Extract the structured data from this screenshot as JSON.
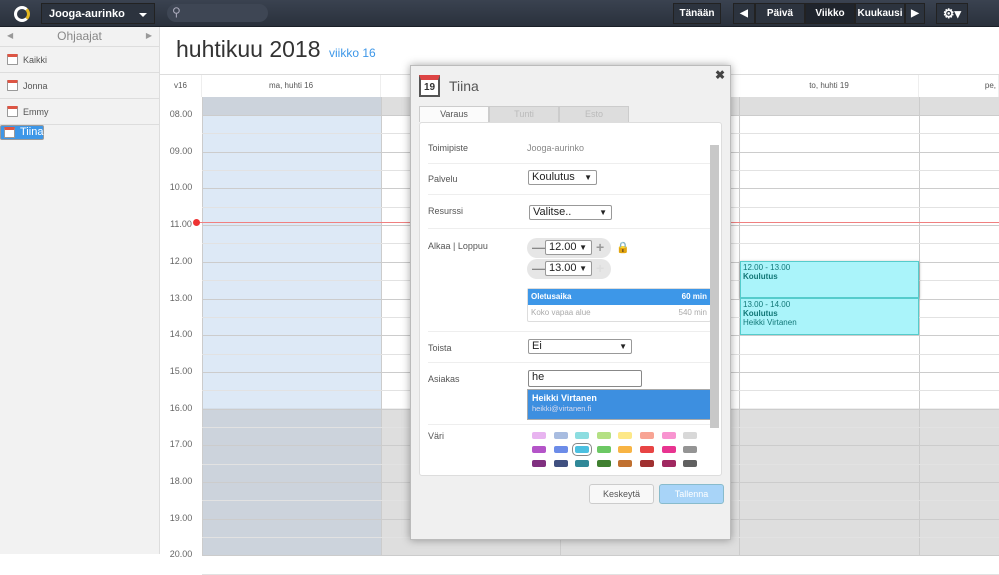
{
  "topbar": {
    "location": "Jooga-aurinko",
    "today": "Tänään",
    "day": "Päivä",
    "week": "Viikko",
    "month": "Kuukausi"
  },
  "sidebar": {
    "title": "Ohjaajat",
    "items": [
      {
        "label": "Kaikki"
      },
      {
        "label": "Jonna"
      },
      {
        "label": "Emmy"
      },
      {
        "label": "Tiina"
      }
    ]
  },
  "header": {
    "title": "huhtikuu 2018",
    "week": "viikko 16"
  },
  "calendar": {
    "week_label": "v16",
    "days": [
      "ma, huhti 16",
      "to, huhti 19",
      "pe,"
    ],
    "times": [
      "08.00",
      "09.00",
      "10.00",
      "11.00",
      "12.00",
      "13.00",
      "14.00",
      "15.00",
      "16.00",
      "17.00",
      "18.00",
      "19.00",
      "20.00"
    ],
    "events": [
      {
        "time": "12.00 - 13.00",
        "title": "Koulutus",
        "customer": ""
      },
      {
        "time": "13.00 - 14.00",
        "title": "Koulutus",
        "customer": "Heikki Virtanen"
      }
    ]
  },
  "modal": {
    "calendar_day": "19",
    "title": "Tiina",
    "tabs": [
      "Varaus",
      "Tunti",
      "Esto"
    ],
    "toimipiste_label": "Toimipiste",
    "toimipiste_value": "Jooga-aurinko",
    "palvelu_label": "Palvelu",
    "palvelu_value": "Koulutus",
    "resurssi_label": "Resurssi",
    "resurssi_value": "Valitse..",
    "time_label": "Alkaa | Loppuu",
    "start": "12.00",
    "end": "13.00",
    "durations": [
      {
        "label": "Oletusaika",
        "value": "60 min"
      },
      {
        "label": "Koko vapaa alue",
        "value": "540 min"
      }
    ],
    "toista_label": "Toista",
    "toista_value": "Ei",
    "asiakas_label": "Asiakas",
    "asiakas_value": "he",
    "suggestion": {
      "name": "Heikki Virtanen",
      "email": "heikki@virtanen.fi"
    },
    "vari_label": "Väri",
    "colors": [
      "#e8b4f0",
      "#a8bce0",
      "#8cdde0",
      "#b4e084",
      "#fde888",
      "#f8a494",
      "#f894d0",
      "#d8d8d8",
      "#b454c8",
      "#6c8ce8",
      "#4cc0e0",
      "#6cc864",
      "#f8b444",
      "#e84444",
      "#e83490",
      "#949494",
      "#803080",
      "#405080",
      "#308898",
      "#408030",
      "#c07030",
      "#a03030",
      "#a02860",
      "#606060"
    ],
    "cancel": "Keskeytä",
    "save": "Tallenna"
  }
}
